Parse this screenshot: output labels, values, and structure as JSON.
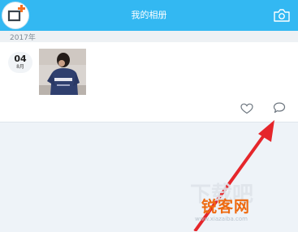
{
  "header": {
    "title": "我的相册",
    "publish_icon": "photo-plus-icon",
    "camera_icon": "camera-icon"
  },
  "timeline": {
    "year": "2017年"
  },
  "post": {
    "day": "04",
    "month": "8月",
    "like_icon": "heart-icon",
    "comment_icon": "comment-icon"
  },
  "watermark": {
    "brand": "锐客网",
    "url": "www.xiazaiba.com"
  },
  "colors": {
    "header_bg": "#33b8f2",
    "accent_orange": "#f46f20",
    "arrow_red": "#e5262b",
    "page_bg": "#eef3f8"
  }
}
